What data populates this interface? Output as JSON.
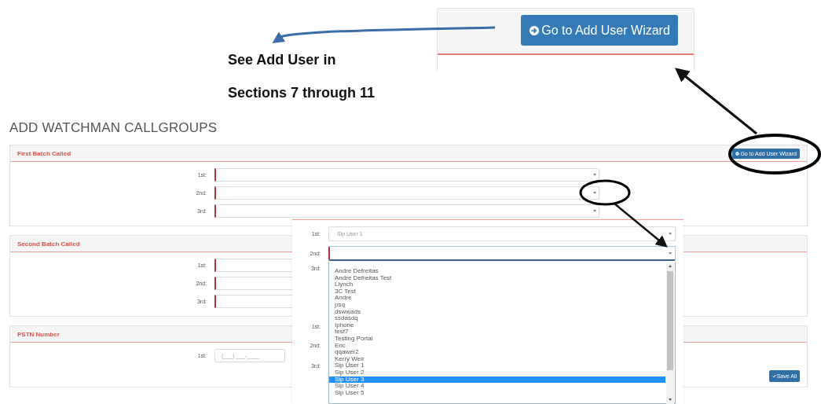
{
  "top_panel": {
    "button": "Go to Add User Wizard"
  },
  "note": [
    "See Add User in",
    "Sections 7 through 11"
  ],
  "title": "ADD WATCHMAN CALLGROUPS",
  "sections": [
    {
      "heading": "First Batch Called",
      "header_button": "Go to Add User Wizard",
      "fields": [
        {
          "label": "1st:",
          "kind": "select"
        },
        {
          "label": "2nd:",
          "kind": "select"
        },
        {
          "label": "3rd:",
          "kind": "select"
        }
      ]
    },
    {
      "heading": "Second Batch Called",
      "fields": [
        {
          "label": "1st:",
          "kind": "select"
        },
        {
          "label": "2nd:",
          "kind": "select"
        },
        {
          "label": "3rd:",
          "kind": "select"
        }
      ]
    },
    {
      "heading": "PSTN Number",
      "fields": [
        {
          "label": "1st:",
          "kind": "phone",
          "placeholder": "(___) ___-____"
        }
      ],
      "footer_button": "Save All"
    }
  ],
  "popup": {
    "fields": [
      {
        "label": "1st:",
        "value": "Sip User 1",
        "open": false
      },
      {
        "label": "2nd:",
        "open": true
      }
    ],
    "background_labels": [
      "3rd:",
      "1st:",
      "2nd:",
      "3rd:"
    ],
    "options": [
      {
        "text": "Andre Defreitas",
        "selected": false
      },
      {
        "text": "Andre Defreitas Test",
        "selected": false
      },
      {
        "text": "Llynch",
        "selected": false
      },
      {
        "text": "3C Test",
        "selected": false
      },
      {
        "text": "Andre",
        "selected": false
      },
      {
        "text": "psq",
        "selected": false
      },
      {
        "text": "dswwads",
        "selected": false
      },
      {
        "text": "ssdasdq",
        "selected": false
      },
      {
        "text": "Iphone",
        "selected": false
      },
      {
        "text": "test7",
        "selected": false
      },
      {
        "text": "Testing Portal",
        "selected": false
      },
      {
        "text": "Eric",
        "selected": false
      },
      {
        "text": "qqawer2",
        "selected": false
      },
      {
        "text": "Kerry Weir",
        "selected": false
      },
      {
        "text": "Sip User 1",
        "selected": false
      },
      {
        "text": "Sip User 2",
        "selected": false
      },
      {
        "text": "Sip User 3",
        "selected": true
      },
      {
        "text": "Sip User 4",
        "selected": false
      },
      {
        "text": "Sip User 5",
        "selected": false
      }
    ]
  }
}
